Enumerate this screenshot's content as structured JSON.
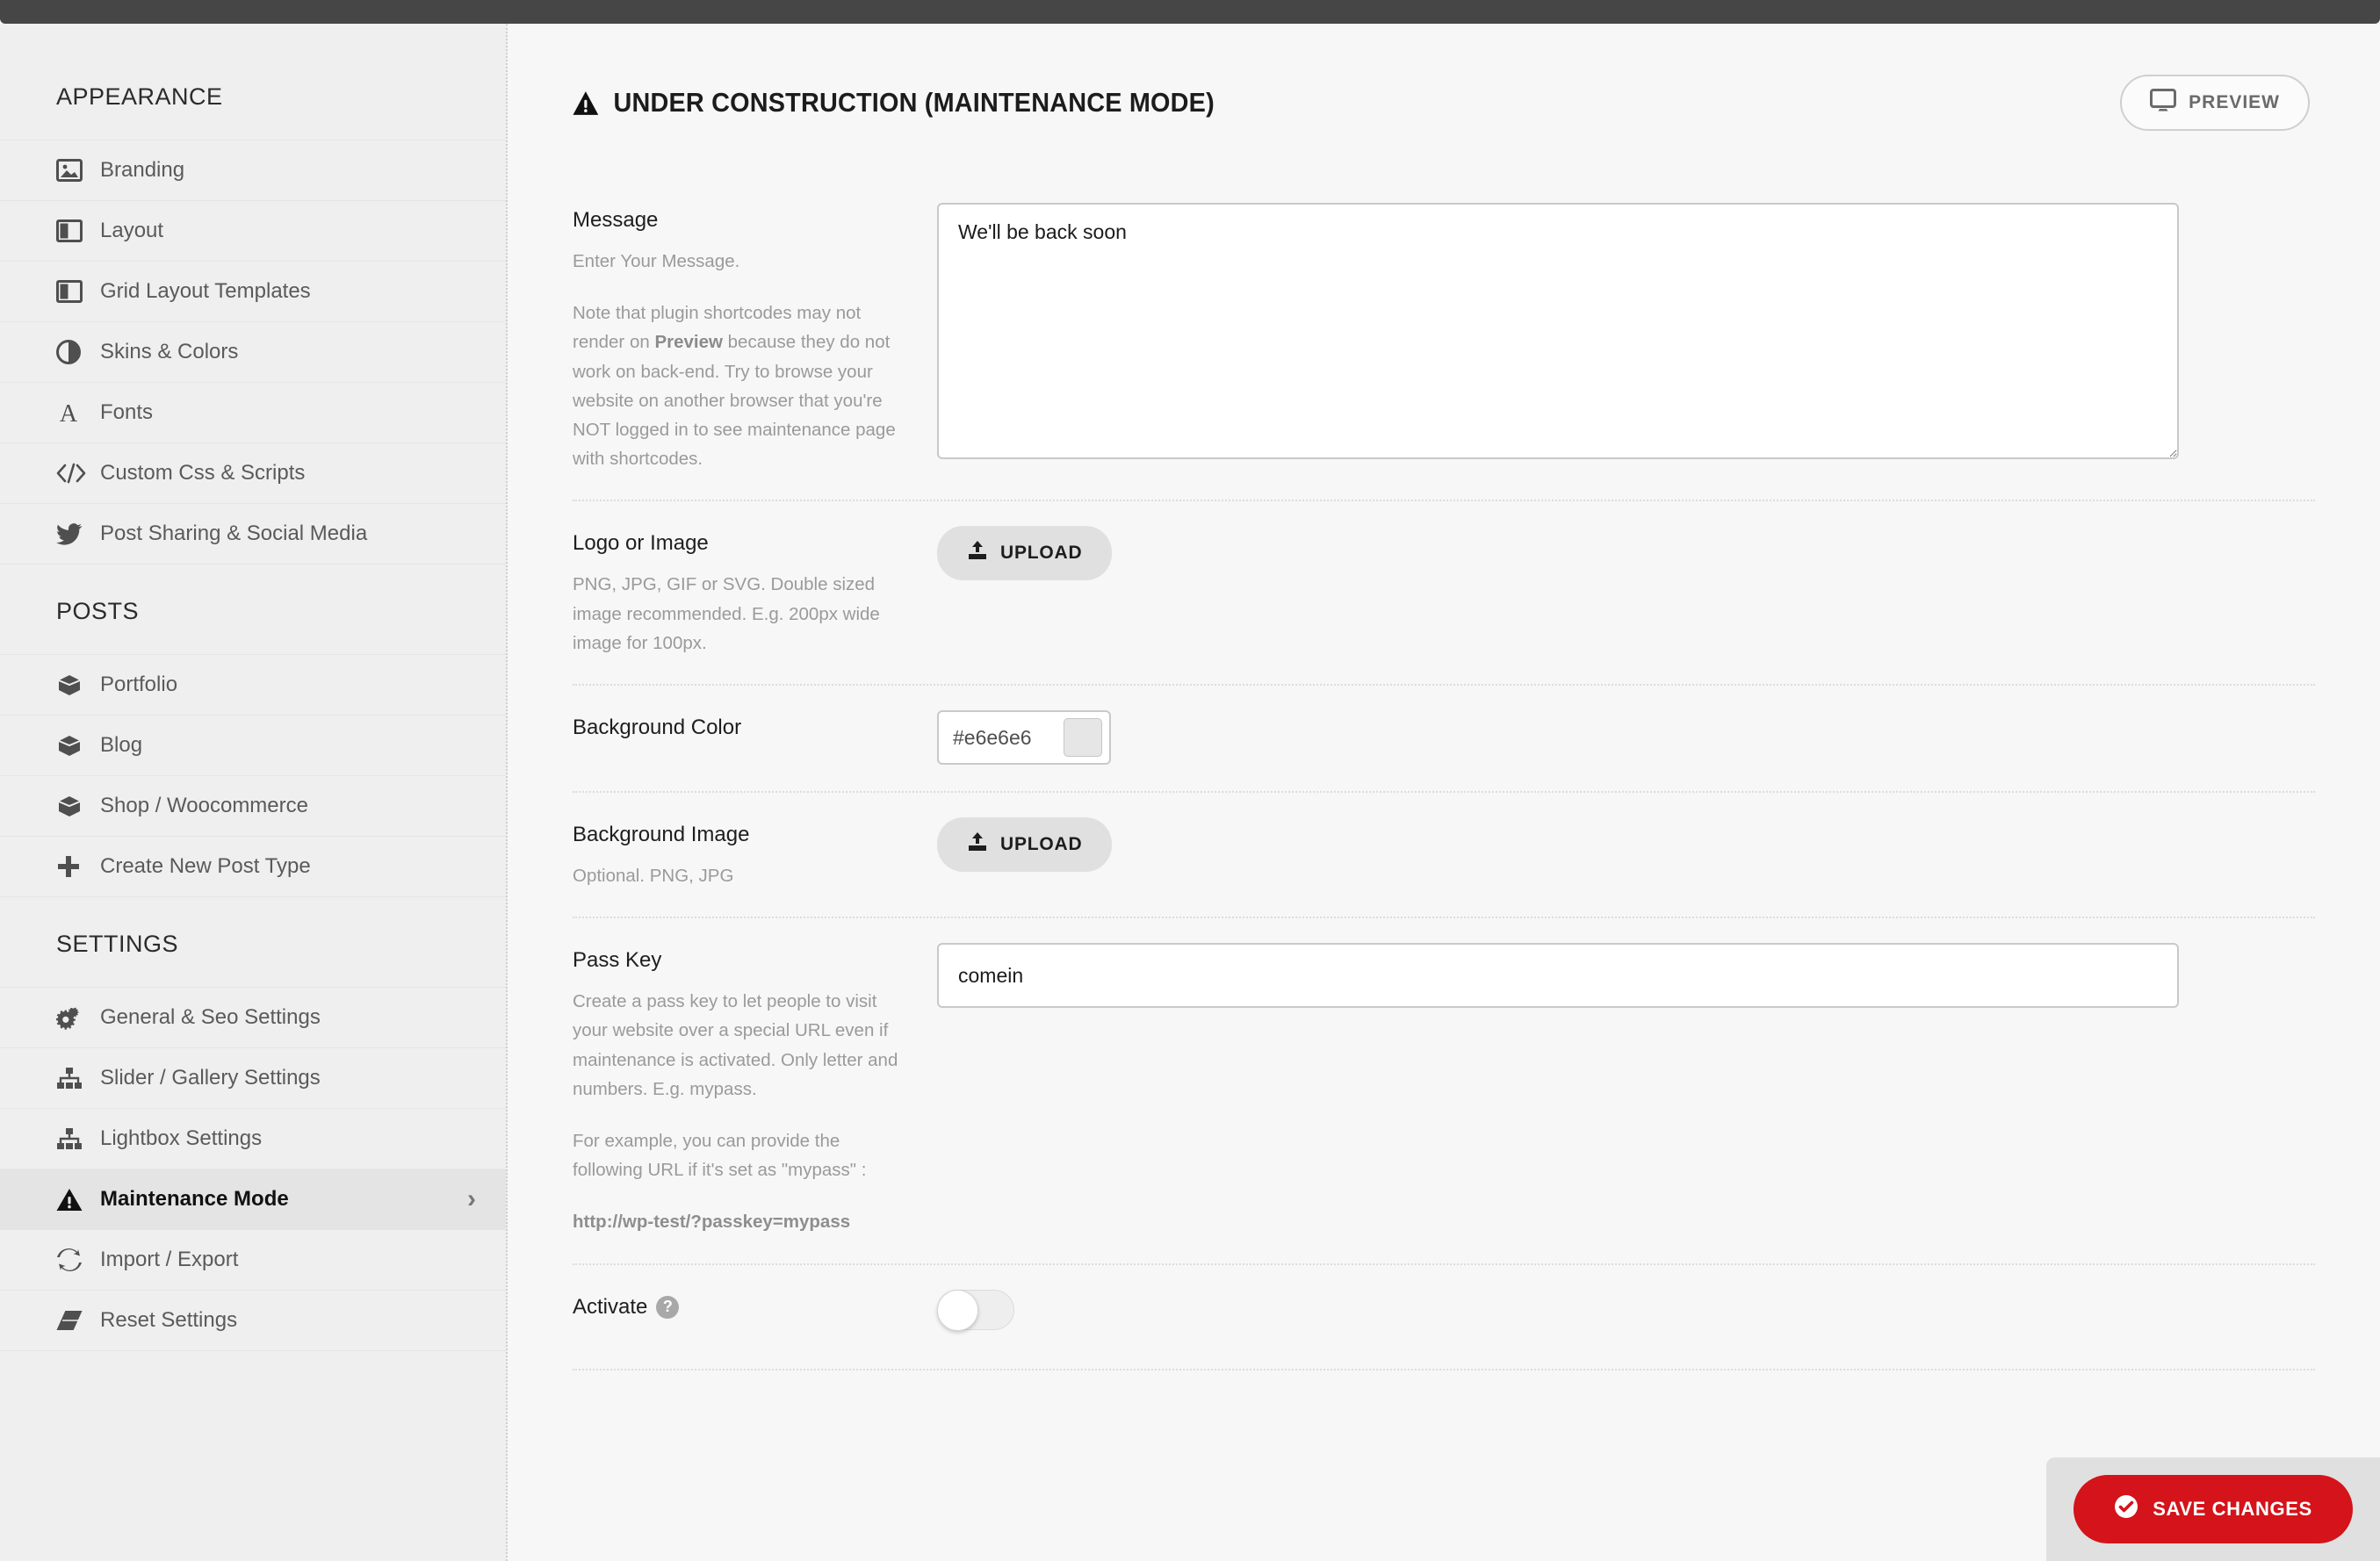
{
  "sidebar": {
    "sections": [
      {
        "heading": "APPEARANCE",
        "items": [
          {
            "label": "Branding",
            "icon": "image-icon"
          },
          {
            "label": "Layout",
            "icon": "columns-icon"
          },
          {
            "label": "Grid Layout Templates",
            "icon": "columns-icon"
          },
          {
            "label": "Skins & Colors",
            "icon": "contrast-circle-icon"
          },
          {
            "label": "Fonts",
            "icon": "letter-a-icon"
          },
          {
            "label": "Custom Css & Scripts",
            "icon": "code-icon"
          },
          {
            "label": "Post Sharing & Social Media",
            "icon": "twitter-bird-icon"
          }
        ]
      },
      {
        "heading": "POSTS",
        "items": [
          {
            "label": "Portfolio",
            "icon": "box-icon"
          },
          {
            "label": "Blog",
            "icon": "box-icon"
          },
          {
            "label": "Shop / Woocommerce",
            "icon": "box-icon"
          },
          {
            "label": "Create New Post Type",
            "icon": "plus-icon"
          }
        ]
      },
      {
        "heading": "SETTINGS",
        "items": [
          {
            "label": "General & Seo Settings",
            "icon": "gears-icon"
          },
          {
            "label": "Slider / Gallery Settings",
            "icon": "sitemap-icon"
          },
          {
            "label": "Lightbox Settings",
            "icon": "sitemap-icon"
          },
          {
            "label": "Maintenance Mode",
            "icon": "warning-triangle-icon",
            "active": true,
            "chevron": "›"
          },
          {
            "label": "Import / Export",
            "icon": "refresh-icon"
          },
          {
            "label": "Reset Settings",
            "icon": "eraser-icon"
          }
        ]
      }
    ]
  },
  "header": {
    "title": "UNDER CONSTRUCTION (MAINTENANCE MODE)",
    "title_icon": "warning-triangle-icon",
    "preview_label": "PREVIEW",
    "preview_icon": "monitor-icon"
  },
  "form": {
    "message": {
      "label": "Message",
      "desc1": "Enter Your Message.",
      "desc2_pre": "Note that plugin shortcodes may not render on ",
      "desc2_bold": "Preview",
      "desc2_post": " because they do not work on back-end. Try to browse your website on another browser that you're NOT logged in to see maintenance page with shortcodes.",
      "value": "We'll be back soon"
    },
    "logo": {
      "label": "Logo or Image",
      "desc": "PNG, JPG, GIF or SVG. Double sized image recommended. E.g. 200px wide image for 100px.",
      "upload_label": "UPLOAD",
      "upload_icon": "upload-icon"
    },
    "background_color": {
      "label": "Background Color",
      "value": "#e6e6e6",
      "swatch_color": "#e6e6e6"
    },
    "background_image": {
      "label": "Background Image",
      "desc": "Optional. PNG, JPG",
      "upload_label": "UPLOAD",
      "upload_icon": "upload-icon"
    },
    "passkey": {
      "label": "Pass Key",
      "desc1": "Create a pass key to let people to visit your website over a special URL even if maintenance is activated. Only letter and numbers. E.g. mypass.",
      "desc2": "For example, you can provide the following URL if it's set as \"mypass\" :",
      "example_url": "http://wp-test/?passkey=mypass",
      "value": "comein"
    },
    "activate": {
      "label": "Activate",
      "help_icon": "question-circle-icon",
      "state": "off"
    }
  },
  "footer": {
    "save_label": "SAVE CHANGES",
    "save_icon": "check-circle-icon",
    "save_color": "#d4131a"
  }
}
